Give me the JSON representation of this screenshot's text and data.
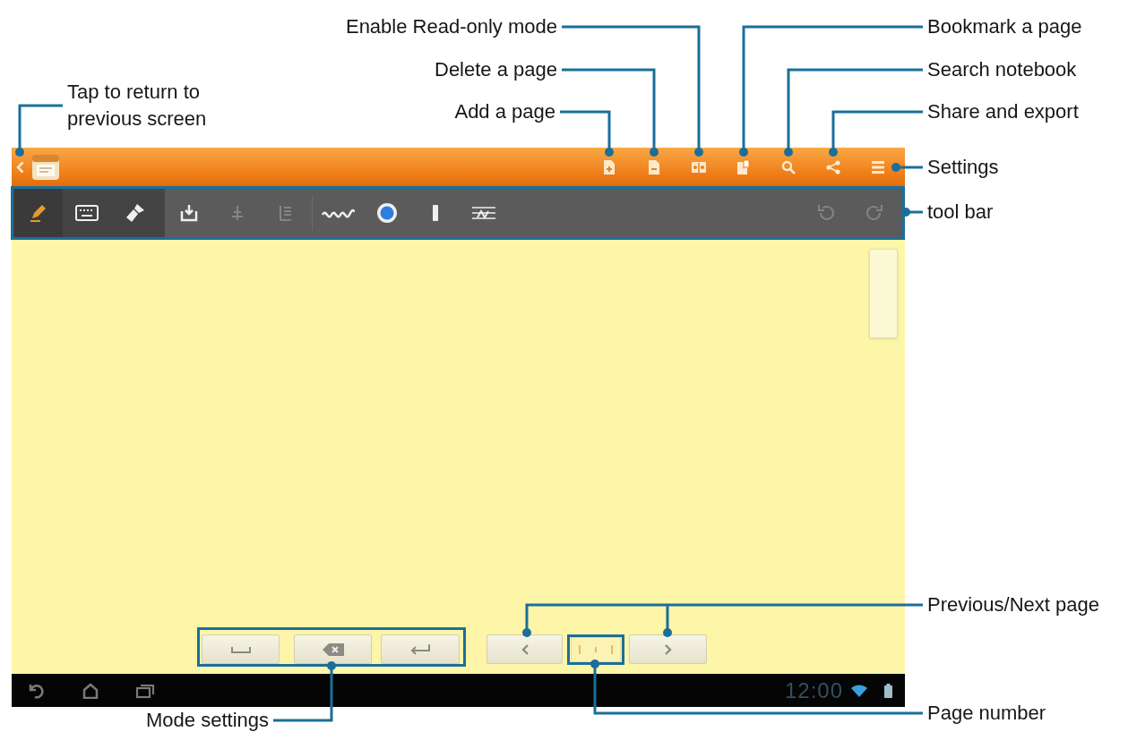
{
  "callouts": [
    "Enable Read-only mode",
    "Bookmark a page",
    "Delete a page",
    "Search notebook",
    "Tap to return to previous screen",
    "Add a page",
    "Share and export",
    "Settings",
    "tool bar",
    "Previous/Next page",
    "Page number",
    "Mode settings"
  ],
  "toolbar": {
    "modes": [
      {
        "selected": true
      },
      {
        "selected": false
      },
      {
        "selected": false
      }
    ],
    "tools": [
      {
        "disabled": false
      },
      {
        "disabled": true
      },
      {
        "disabled": true
      },
      {
        "disabled": false
      },
      {
        "disabled": false,
        "color": "#2f7de1"
      },
      {
        "disabled": false
      },
      {
        "disabled": false
      }
    ],
    "history": [
      {
        "disabled": true
      },
      {
        "disabled": true
      }
    ]
  },
  "status_bar": {
    "clock": "12:00"
  }
}
